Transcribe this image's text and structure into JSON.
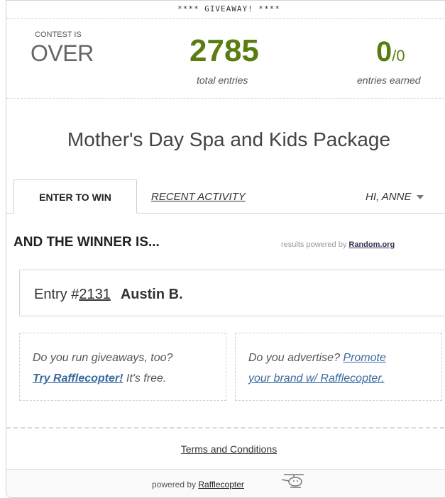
{
  "banner": "**** GIVEAWAY! ****",
  "stats": {
    "contest_label": "CONTEST IS",
    "contest_status": "OVER",
    "total_entries": "2785",
    "total_label": "total entries",
    "earned": "0",
    "earned_max": "/0",
    "earned_label": "entries earned"
  },
  "title": "Mother's Day Spa and Kids Package",
  "tabs": {
    "enter": "ENTER TO WIN",
    "recent": "RECENT ACTIVITY",
    "user": "HI, ANNE"
  },
  "winner": {
    "heading": "AND THE WINNER IS...",
    "powered_prefix": "results powered by",
    "powered_link": "Random.org",
    "entry_prefix": "Entry #",
    "entry_number": "2131",
    "name": "Austin B."
  },
  "promo_left": {
    "line1": "Do you run giveaways, too?",
    "link": "Try Rafflecopter!",
    "suffix": " It's free."
  },
  "promo_right": {
    "prefix": "Do you advertise? ",
    "link1": "Promote",
    "link2": "your brand w/ Rafflecopter."
  },
  "terms": "Terms and Conditions",
  "footer": {
    "prefix": "powered by",
    "link": "Rafflecopter"
  },
  "colors": {
    "accent_green": "#5a7d12",
    "link_blue": "#3b6aa0"
  }
}
